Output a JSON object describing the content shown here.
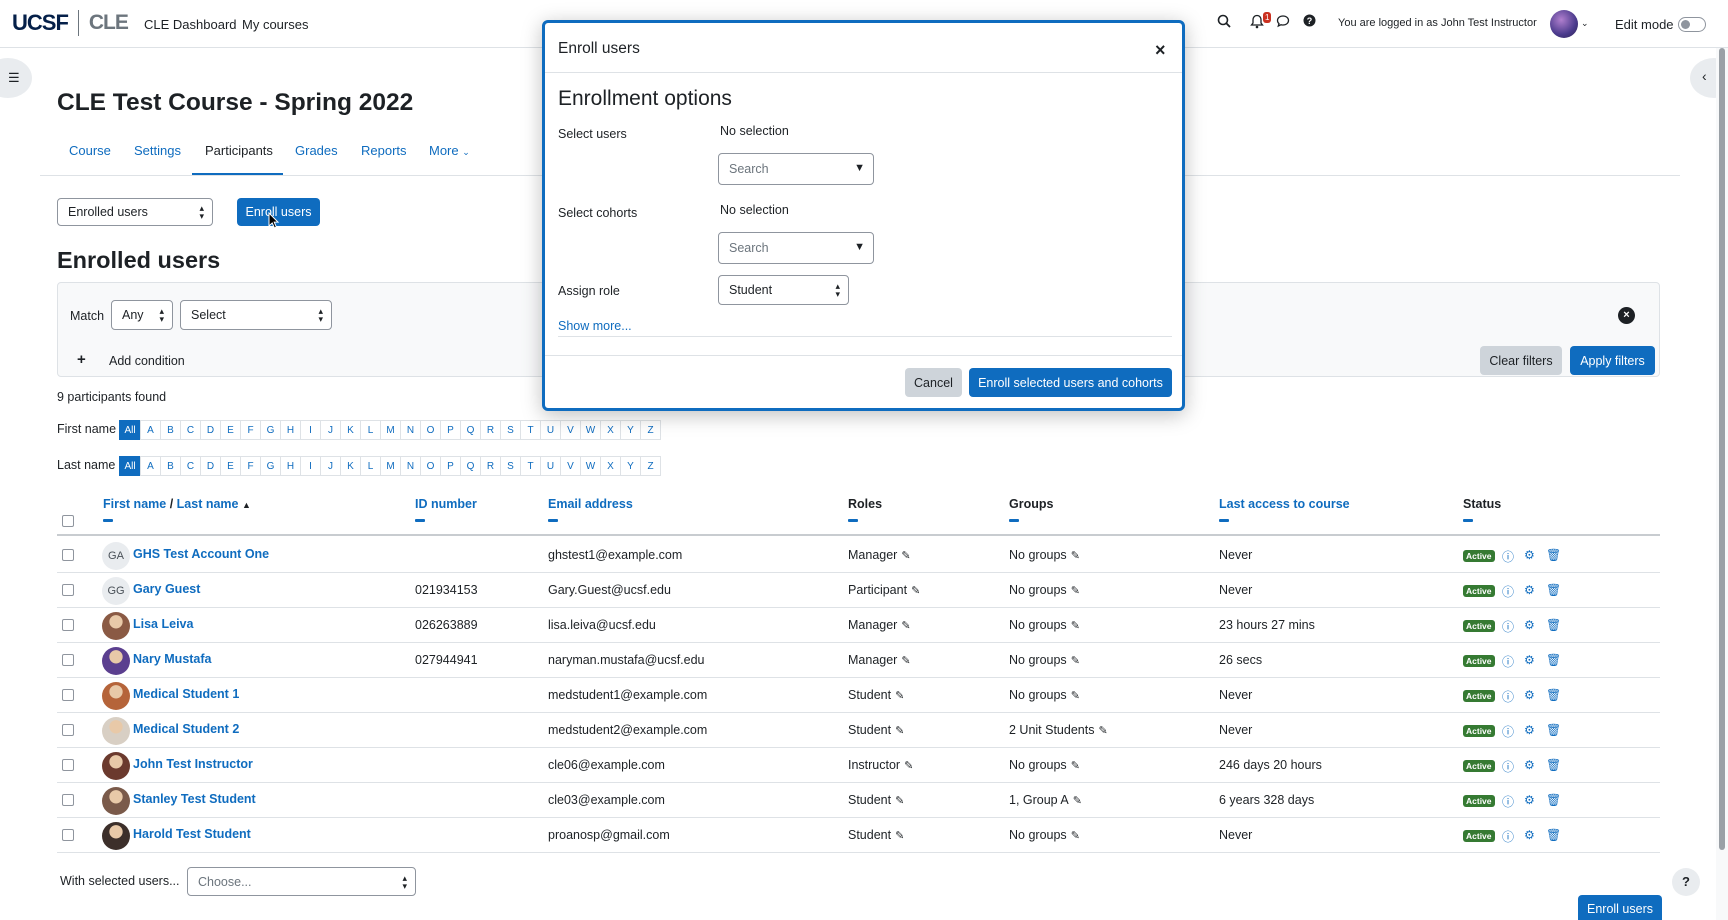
{
  "navbar": {
    "logo_main": "UCSF",
    "logo_sub": "CLE",
    "links": [
      "CLE Dashboard",
      "My courses"
    ],
    "notification_count": "1",
    "logged_in_text": "You are logged in as John Test Instructor",
    "edit_mode_label": "Edit mode"
  },
  "course": {
    "title": "CLE Test Course - Spring 2022",
    "tabs": [
      "Course",
      "Settings",
      "Participants",
      "Grades",
      "Reports",
      "More"
    ]
  },
  "controls": {
    "enrolled_select": "Enrolled users",
    "enroll_button": "Enroll users"
  },
  "heading": "Enrolled users",
  "filter": {
    "match_label": "Match",
    "match_value": "Any",
    "select_value": "Select",
    "add_condition": "Add condition",
    "clear_filters": "Clear filters",
    "apply_filters": "Apply filters"
  },
  "participants_found": "9 participants found",
  "initials": {
    "first_label": "First name",
    "last_label": "Last name",
    "all": "All",
    "letters": [
      "A",
      "B",
      "C",
      "D",
      "E",
      "F",
      "G",
      "H",
      "I",
      "J",
      "K",
      "L",
      "M",
      "N",
      "O",
      "P",
      "Q",
      "R",
      "S",
      "T",
      "U",
      "V",
      "W",
      "X",
      "Y",
      "Z"
    ]
  },
  "table": {
    "headers": {
      "first_name": "First name",
      "slash": "/",
      "last_name": "Last name",
      "id_number": "ID number",
      "email": "Email address",
      "roles": "Roles",
      "groups": "Groups",
      "last_access": "Last access to course",
      "status": "Status"
    },
    "status_label": "Active",
    "rows": [
      {
        "initials": "GA",
        "name": "GHS Test Account One",
        "id": "",
        "email": "ghstest1@example.com",
        "role": "Manager",
        "groups": "No groups",
        "access": "Never",
        "avatar": ""
      },
      {
        "initials": "GG",
        "name": "Gary Guest",
        "id": "021934153",
        "email": "Gary.Guest@ucsf.edu",
        "role": "Participant",
        "groups": "No groups",
        "access": "Never",
        "avatar": ""
      },
      {
        "initials": "",
        "name": "Lisa Leiva",
        "id": "026263889",
        "email": "lisa.leiva@ucsf.edu",
        "role": "Manager",
        "groups": "No groups",
        "access": "23 hours 27 mins",
        "avatar": "#8a5a44"
      },
      {
        "initials": "",
        "name": "Nary Mustafa",
        "id": "027944941",
        "email": "naryman.mustafa@ucsf.edu",
        "role": "Manager",
        "groups": "No groups",
        "access": "26 secs",
        "avatar": "#5b3f8f"
      },
      {
        "initials": "",
        "name": "Medical Student 1",
        "id": "",
        "email": "medstudent1@example.com",
        "role": "Student",
        "groups": "No groups",
        "access": "Never",
        "avatar": "#b5643a"
      },
      {
        "initials": "",
        "name": "Medical Student 2",
        "id": "",
        "email": "medstudent2@example.com",
        "role": "Student",
        "groups": "2 Unit Students",
        "access": "Never",
        "avatar": "#d8cfc4"
      },
      {
        "initials": "",
        "name": "John Test Instructor",
        "id": "",
        "email": "cle06@example.com",
        "role": "Instructor",
        "groups": "No groups",
        "access": "246 days 20 hours",
        "avatar": "#6b3a2e"
      },
      {
        "initials": "",
        "name": "Stanley Test Student",
        "id": "",
        "email": "cle03@example.com",
        "role": "Student",
        "groups": "1, Group A",
        "access": "6 years 328 days",
        "avatar": "#7a5a4a"
      },
      {
        "initials": "",
        "name": "Harold Test Student",
        "id": "",
        "email": "proanosp@gmail.com",
        "role": "Student",
        "groups": "No groups",
        "access": "Never",
        "avatar": "#3c2f2a"
      }
    ]
  },
  "footer": {
    "with_selected": "With selected users...",
    "choose": "Choose...",
    "enroll_button": "Enroll users",
    "help": "?"
  },
  "modal": {
    "title": "Enroll users",
    "subtitle": "Enrollment options",
    "select_users_label": "Select users",
    "select_users_value": "No selection",
    "search_placeholder": "Search",
    "select_cohorts_label": "Select cohorts",
    "select_cohorts_value": "No selection",
    "assign_role_label": "Assign role",
    "assign_role_value": "Student",
    "show_more": "Show more...",
    "cancel": "Cancel",
    "submit": "Enroll selected users and cohorts"
  }
}
